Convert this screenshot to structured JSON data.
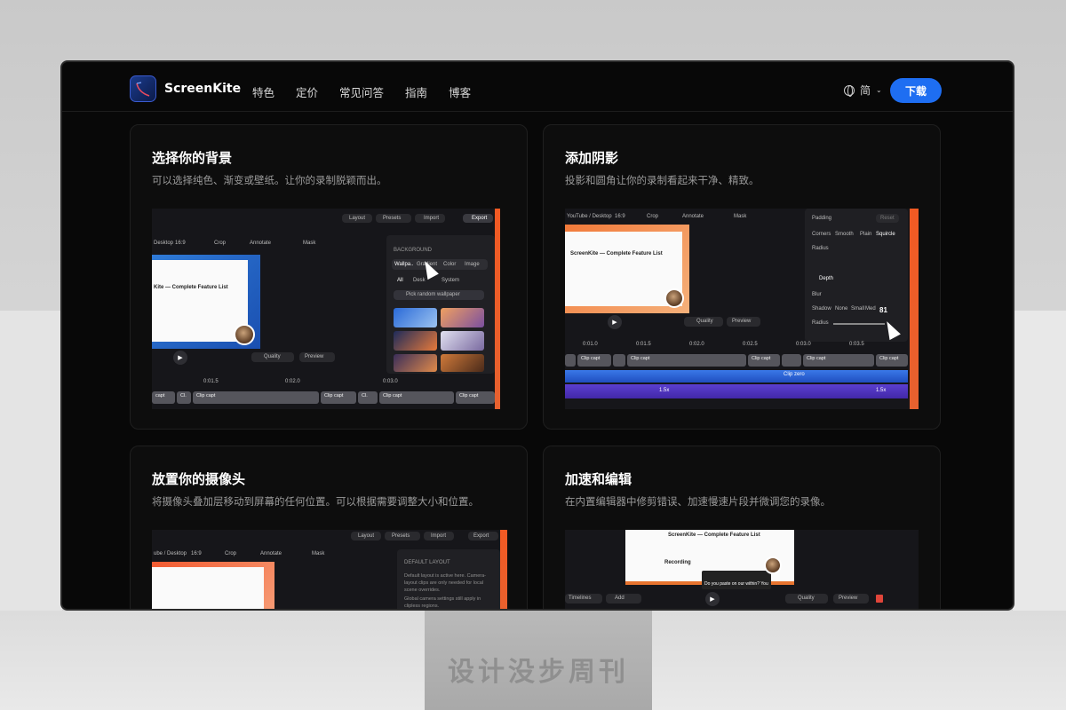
{
  "nav": {
    "brand": "ScreenKite",
    "links": [
      "特色",
      "定价",
      "常见问答",
      "指南",
      "博客"
    ],
    "lang": "简",
    "download": "下载"
  },
  "cards": [
    {
      "title": "选择你的背景",
      "desc": "可以选择纯色、渐变或壁纸。让你的录制脱颖而出。",
      "ui": {
        "toolbar": [
          "Layout",
          "Presets",
          "Import",
          "Export"
        ],
        "bar": [
          "Desktop",
          "16:9",
          "Crop",
          "Annotate",
          "Mask"
        ],
        "panel_title": "BACKGROUND",
        "tabs": [
          "Wallpa..",
          "Gradient",
          "Color",
          "Image"
        ],
        "filters": [
          "All",
          "Desk",
          "System"
        ],
        "pick": "Pick random wallpaper",
        "quality": "Quality",
        "preview": "Preview",
        "times": [
          "0:01.5",
          "0:02.0",
          "0:03.0"
        ],
        "clips": [
          "capt",
          "Cl.",
          "Clip capt",
          "Clip capt",
          "Cl.",
          "Clip capt",
          "Clip capt"
        ],
        "doc_title": "Kite — Complete Feature List"
      }
    },
    {
      "title": "添加阴影",
      "desc": "投影和圆角让你的录制看起来干净、精致。",
      "ui": {
        "bar": [
          "YouTube / Desktop",
          "16:9",
          "Crop",
          "Annotate",
          "Mask"
        ],
        "padding": "Padding",
        "reset": "Reset",
        "corners": "Corners",
        "corner_opts": [
          "Smooth",
          "Plain",
          "Squircle"
        ],
        "radius": "Radius",
        "depth": "Depth",
        "blur": "Blur",
        "shadow": "Shadow",
        "shadow_opts": [
          "None",
          "Small",
          "Med"
        ],
        "value": "81",
        "quality": "Quality",
        "preview": "Preview",
        "times": [
          "0:01.0",
          "0:01.5",
          "0:02.0",
          "0:02.5",
          "0:03.0",
          "0:03.5"
        ],
        "clips": [
          "Clip capt",
          "Clip capt",
          "Clip capt",
          "Clip capt",
          "Clip capt",
          "Clip capt",
          "Clip capt"
        ],
        "clip_zero": "Clip zero",
        "speed": "1.5x",
        "doc_title": "ScreenKite — Complete Feature List"
      }
    },
    {
      "title": "放置你的摄像头",
      "desc": "将摄像头叠加层移动到屏幕的任何位置。可以根据需要调整大小和位置。",
      "ui": {
        "toolbar": [
          "Layout",
          "Presets",
          "Import",
          "Export"
        ],
        "bar": [
          "ube / Desktop",
          "16:9",
          "Crop",
          "Annotate",
          "Mask"
        ],
        "panel_title": "DEFAULT LAYOUT",
        "panel_text_1": "Default layout is active here. Camera-layout clips are only needed for local scene overrides.",
        "panel_text_2": "Global camera settings still apply in clipless regions."
      }
    },
    {
      "title": "加速和编辑",
      "desc": "在内置编辑器中修剪错误、加速慢速片段并微调您的录像。",
      "ui": {
        "doc_title": "ScreenKite — Complete Feature List",
        "doc_section": "Recording",
        "tooltip": "Do you paste on our within? You",
        "bottom": [
          "Timelines",
          "Add",
          "Quality",
          "Preview"
        ]
      }
    }
  ],
  "watermark": "设计没步周刊"
}
